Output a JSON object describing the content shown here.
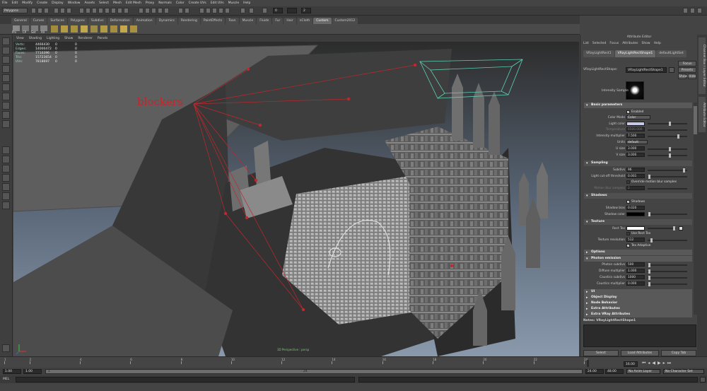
{
  "menus": [
    "File",
    "Edit",
    "Modify",
    "Create",
    "Display",
    "Window",
    "Assets",
    "Select",
    "Mesh",
    "Edit Mesh",
    "Proxy",
    "Normals",
    "Color",
    "Create UVs",
    "Edit UVs",
    "Muscle",
    "Help"
  ],
  "module": "Polygons",
  "status_fields": [
    "0",
    "2"
  ],
  "shelf_tabs": [
    "General",
    "Curves",
    "Surfaces",
    "Polygons",
    "Subdivs",
    "Deformation",
    "Animation",
    "Dynamics",
    "Rendering",
    "PaintEffects",
    "Toon",
    "Muscle",
    "Fluids",
    "Fur",
    "Hair",
    "nCloth",
    "Custom",
    "Custom2012"
  ],
  "shelf_tab_active": "Custom",
  "shelf_labels": [
    "Prx",
    "CP",
    "Set",
    "All"
  ],
  "panel_menus": [
    "View",
    "Shading",
    "Lighting",
    "Show",
    "Renderer",
    "Panels"
  ],
  "hud": [
    {
      "label": "Verts:",
      "v1": "4466430",
      "v2": "0",
      "v3": "0"
    },
    {
      "label": "Edges:",
      "v1": "14000472",
      "v2": "0",
      "v3": "0"
    },
    {
      "label": "Faces:",
      "v1": "7710396",
      "v2": "0",
      "v3": "0"
    },
    {
      "label": "Tris:",
      "v1": "15723654",
      "v2": "0",
      "v3": "0"
    },
    {
      "label": "UVs:",
      "v1": "7818697",
      "v2": "0",
      "v3": "0"
    }
  ],
  "annotation": "blockers",
  "camera_label": "3D Perspective : persp",
  "attribute_editor": {
    "title": "Attribute Editor",
    "menu": [
      "List",
      "Selected",
      "Focus",
      "Attributes",
      "Show",
      "Help"
    ],
    "tabs": [
      "VRayLightRect1",
      "VRayLightRectShape1",
      "defaultLightSet"
    ],
    "active_tab": "VRayLightRectShape1",
    "node_label": "VRayLightRectShape:",
    "node_value": "VRayLightRectShape1",
    "side_buttons": [
      "Focus",
      "Presets",
      "Show",
      "Hide"
    ],
    "intensity_sample_label": "Intensity Sample",
    "sections": {
      "basic": "Basic parameters",
      "sampling": "Sampling",
      "shadows": "Shadows",
      "texture": "Texture",
      "options": "Options",
      "photon": "Photon emission",
      "ui": "UI",
      "object_display": "Object Display",
      "node_behavior": "Node Behavior",
      "extra": "Extra Attributes",
      "extra_vray": "Extra VRay Attributes"
    },
    "enabled_label": "Enabled",
    "color_mode_label": "Color Mode",
    "color_mode_value": "Color",
    "light_color_label": "Light color",
    "light_color_hex": "#c7c9e6",
    "temperature_label": "Temperature",
    "temperature_value": "6500.000",
    "intensity_label": "Intensity multiplier",
    "intensity_value": "7.500",
    "units_label": "Units",
    "units_value": "default",
    "usize_label": "U size",
    "usize_value": "3.000",
    "vsize_label": "V size",
    "vsize_value": "3.000",
    "subdivs_label": "Subdivs",
    "subdivs_value": "96",
    "cutoff_label": "Light cut-off threshold",
    "cutoff_value": "0.001",
    "override_mb_label": "Override motion blur samples",
    "mb_samples_label": "Motion blur samples",
    "mb_samples_value": "2",
    "shadows_label": "Shadows",
    "shadow_bias_label": "Shadow bias",
    "shadow_bias_value": "0.020",
    "shadow_color_label": "Shadow color",
    "rect_tex_label": "Rect Tex",
    "use_rect_tex_label": "Use Rect Tex",
    "tex_res_label": "Texture resolution",
    "tex_res_value": "512",
    "tex_adaptive_label": "Tex Adaptive",
    "photon_subdivs_label": "Photon subdivs",
    "photon_subdivs_value": "500",
    "diffuse_mult_label": "Diffuse multiplier",
    "diffuse_mult_value": "1.000",
    "caustics_subdivs_label": "Caustics subdivs",
    "caustics_subdivs_value": "1000",
    "caustics_mult_label": "Caustics multiplier",
    "caustics_mult_value": "0.000",
    "notes_label": "Notes: VRayLightRectShape1",
    "bottom_buttons": [
      "Select",
      "Load Attributes",
      "Copy Tab"
    ],
    "right_tabs": [
      "Channel Box / Layer Editor",
      "Attribute Editor"
    ]
  },
  "timeline": {
    "ticks": [
      "1",
      "2",
      "4",
      "6",
      "8",
      "10",
      "12",
      "14",
      "16",
      "18",
      "20",
      "22",
      "24"
    ],
    "current": "16.00"
  },
  "range": {
    "start": "1.00",
    "start2": "1.00",
    "bar_start": "1",
    "bar_end": "24",
    "end": "24.00",
    "end2": "48.00",
    "anim_layer": "No Anim Layer",
    "char_set": "No Character Set"
  },
  "cmd_label": "MEL"
}
